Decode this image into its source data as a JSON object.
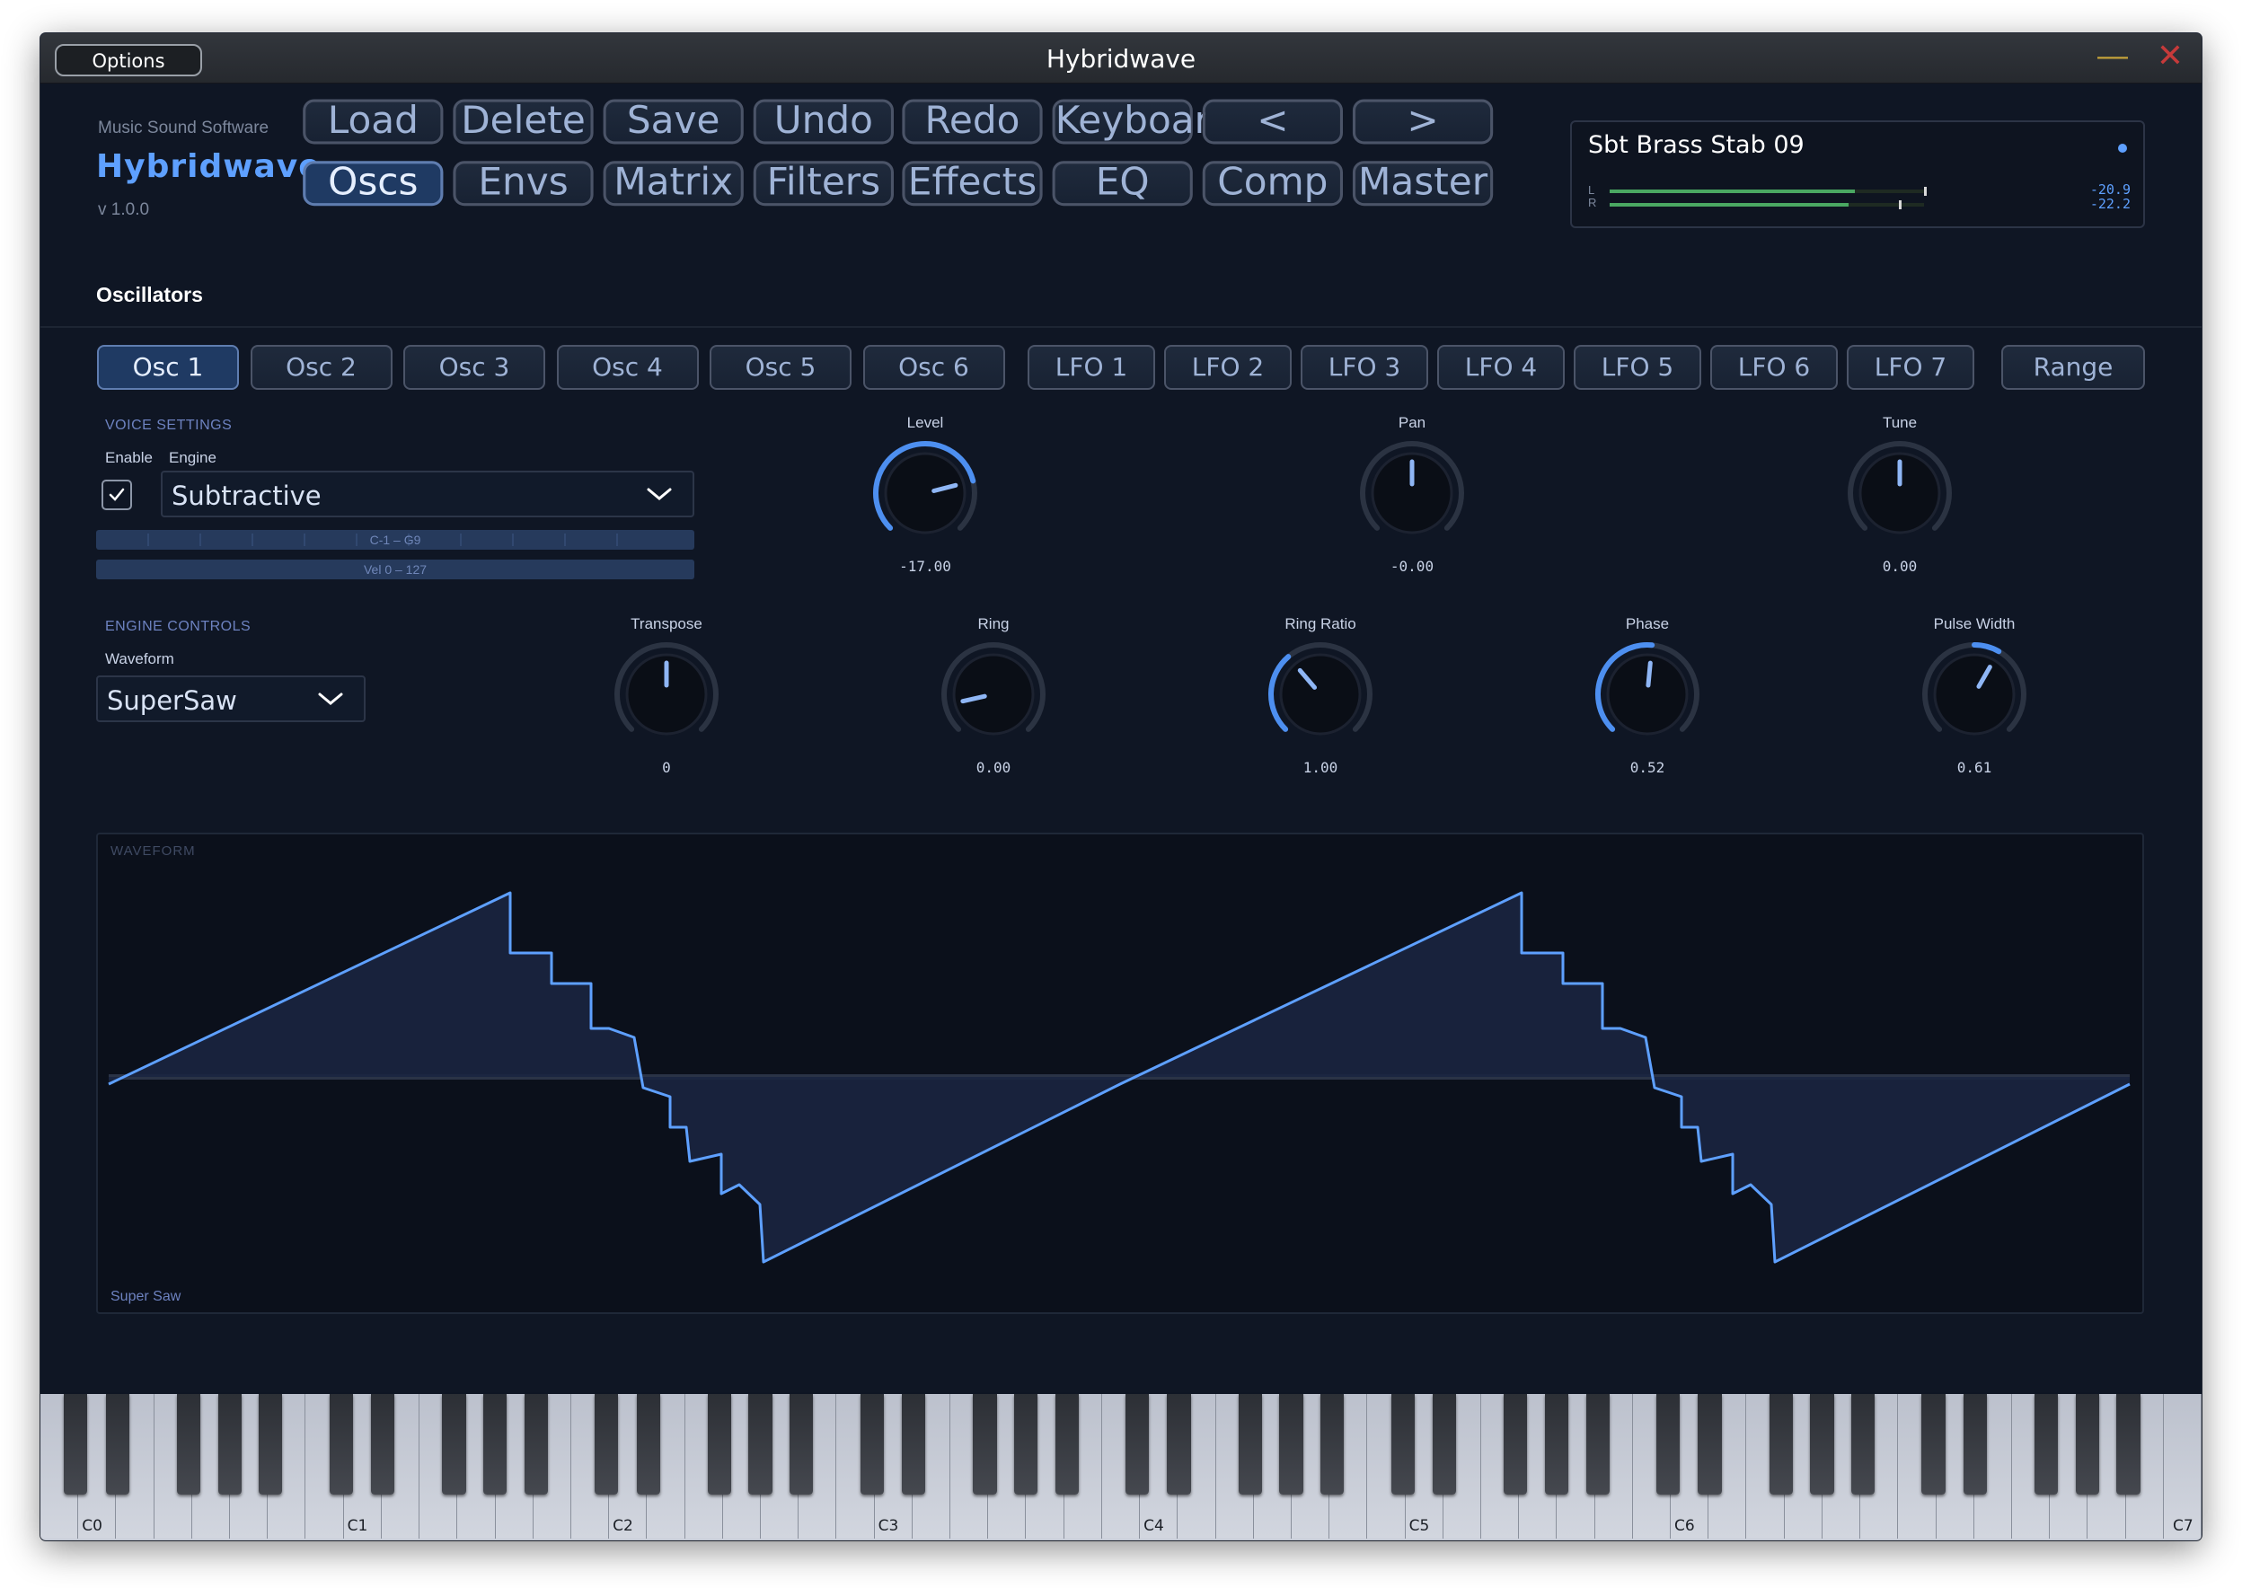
{
  "window": {
    "title": "Hybridwave",
    "options_label": "Options",
    "min_icon": "minimize-icon",
    "close_icon": "close-icon"
  },
  "brand": {
    "maker": "Music Sound Software",
    "name": "Hybridwave",
    "version": "v 1.0.0"
  },
  "toolbar": {
    "row1": [
      "Load",
      "Delete",
      "Save",
      "Undo",
      "Redo",
      "Keyboard",
      "<",
      ">"
    ],
    "row2": [
      "Oscs",
      "Envs",
      "Matrix",
      "Filters",
      "Effects",
      "EQ",
      "Comp",
      "Master"
    ],
    "active": "Oscs"
  },
  "preset": {
    "name": "Sbt Brass Stab 09",
    "left_label": "L",
    "right_label": "R",
    "left_value": "-20.9",
    "right_value": "-22.2",
    "left_level": 0.78,
    "right_level": 0.76
  },
  "section": {
    "title": "Oscillators"
  },
  "tabs": {
    "osc": [
      "Osc 1",
      "Osc 2",
      "Osc 3",
      "Osc 4",
      "Osc 5",
      "Osc 6"
    ],
    "lfo": [
      "LFO 1",
      "LFO 2",
      "LFO 3",
      "LFO 4",
      "LFO 5",
      "LFO 6",
      "LFO 7"
    ],
    "range": "Range",
    "active": "Osc 1"
  },
  "voice": {
    "heading": "VOICE SETTINGS",
    "enable_label": "Enable",
    "engine_label": "Engine",
    "enabled": true,
    "engine": "Subtractive",
    "key_range": "C-1 – G9",
    "vel_range": "Vel 0 – 127"
  },
  "engine_controls": {
    "heading": "ENGINE CONTROLS",
    "waveform_label": "Waveform",
    "waveform": "SuperSaw"
  },
  "knobs_top": [
    {
      "label": "Level",
      "value": "-17.00",
      "level": 0.78,
      "accent": true
    },
    {
      "label": "Pan",
      "value": "-0.00",
      "level": 0.5,
      "accent": false
    },
    {
      "label": "Tune",
      "value": "0.00",
      "level": 0.5,
      "accent": false
    }
  ],
  "knobs_bottom": [
    {
      "label": "Transpose",
      "value": "0",
      "level": 0.5,
      "accent": false
    },
    {
      "label": "Ring",
      "value": "0.00",
      "level": 0.12,
      "accent": false
    },
    {
      "label": "Ring Ratio",
      "value": "1.00",
      "level": 0.35,
      "accent": true
    },
    {
      "label": "Phase",
      "value": "0.52",
      "level": 0.52,
      "accent": true
    },
    {
      "label": "Pulse Width",
      "value": "0.61",
      "level": 0.61,
      "accent": true
    }
  ],
  "waveform_panel": {
    "title": "WAVEFORM",
    "name": "Super Saw"
  },
  "keyboard": {
    "labels": [
      "C0",
      "C1",
      "C2",
      "C3",
      "C4",
      "C5",
      "C6",
      "C7"
    ]
  },
  "colors": {
    "accent": "#5ea0ff",
    "background": "#0f1624",
    "knob_arc": "#4d8ff0",
    "meter": "#4aa862"
  }
}
